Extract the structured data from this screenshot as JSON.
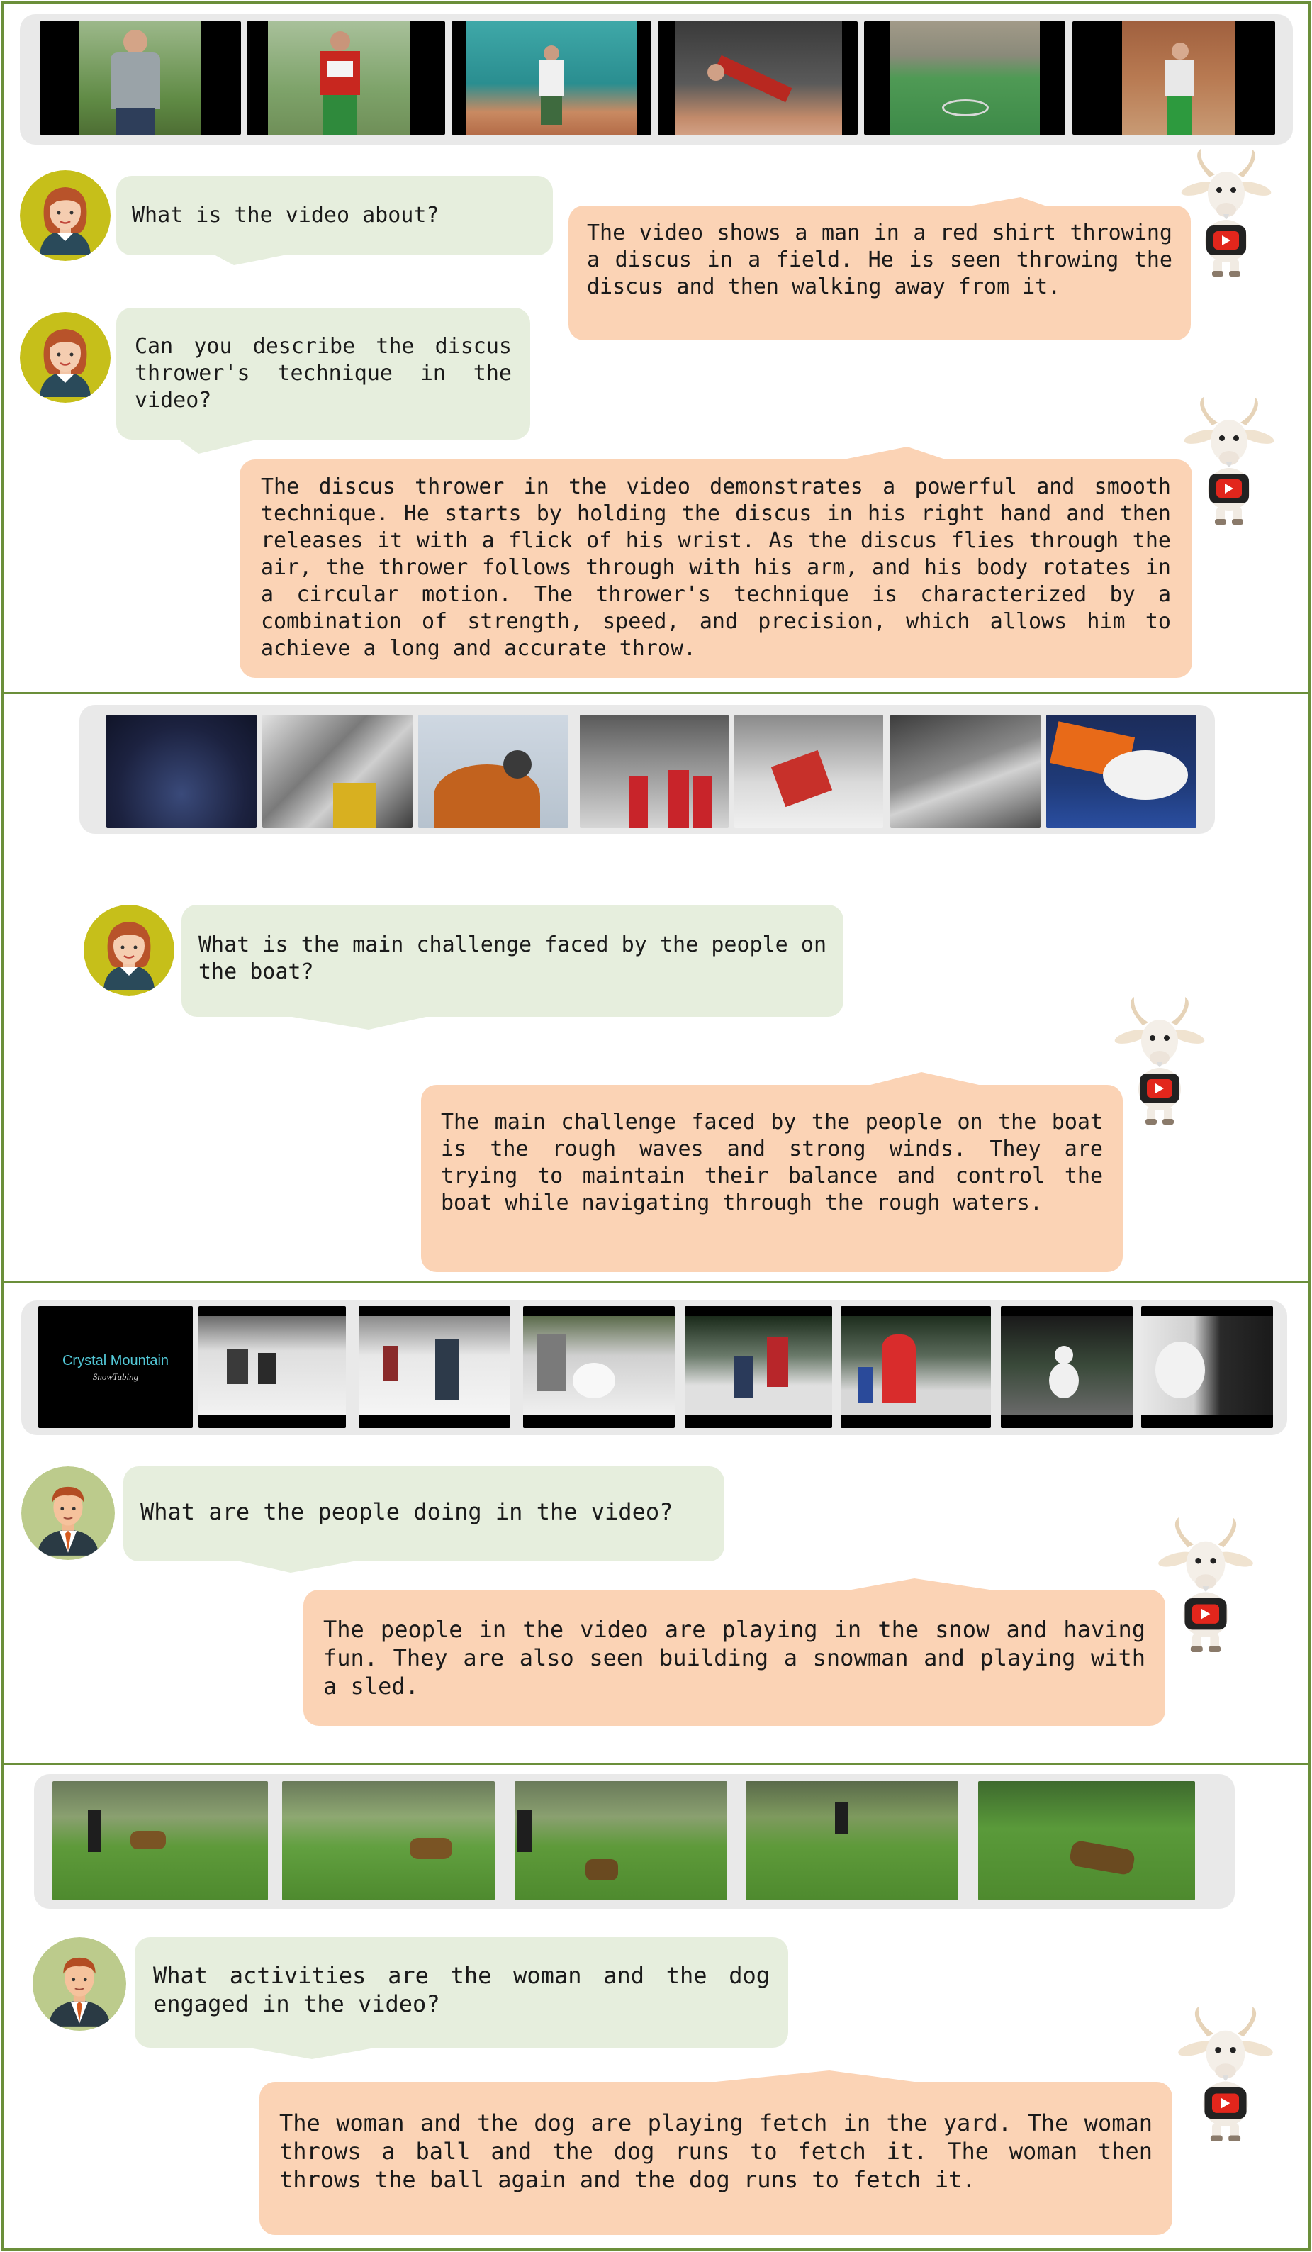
{
  "colors": {
    "panel_border": "#6b8f3a",
    "user_bubble": "#e6eedd",
    "bot_bubble": "#fbd3b5",
    "strip_bg": "#e9e9e9"
  },
  "icons": {
    "user_avatar_woman": "woman-avatar-icon",
    "user_avatar_man": "man-avatar-icon",
    "assistant_avatar": "goat-mascot-icon"
  },
  "panels": [
    {
      "frames": [
        "discus-thrower-portrait",
        "athlete-bib-744",
        "thrower-in-cage",
        "throw-release",
        "field-stadium",
        "thrower-practice"
      ],
      "turns": [
        {
          "role": "user",
          "text": "What is the video about?"
        },
        {
          "role": "assistant",
          "text": "The video shows a man in a red shirt throwing a discus in a field. He is seen throwing the discus and then walking away from it."
        },
        {
          "role": "user",
          "text": "Can you describe the discus thrower's technique in the video?"
        },
        {
          "role": "assistant",
          "text": "The discus thrower in the video demonstrates a powerful and smooth technique. He starts by holding the discus in his right hand and then releases it with a flick of his wrist. As the discus flies through the air, the thrower follows through with his arm, and his body rotates in a circular motion. The thrower's technique is characterized by a combination of strength, speed, and precision, which allows him to achieve a long and accurate throw."
        }
      ]
    },
    {
      "frames": [
        "stormy-sky",
        "boat-deck",
        "sailor-binoculars",
        "crew-red-jackets",
        "boat-splash",
        "rough-sea",
        "sailboat-waves"
      ],
      "turns": [
        {
          "role": "user",
          "text": "What is the main challenge faced by the people on the boat?"
        },
        {
          "role": "assistant",
          "text": "The main challenge faced by the people on the boat is the rough waves and strong winds. They are trying to maintain their balance and control the boat while navigating through the rough waters."
        }
      ]
    },
    {
      "title_card": {
        "title": "Crystal Mountain",
        "subtitle": "SnowTubing"
      },
      "frames": [
        "title-card",
        "sledding-kids",
        "snow-group",
        "rolling-snowball",
        "family-in-snow",
        "red-jacket-kid",
        "snowman",
        "snowman-closeup"
      ],
      "turns": [
        {
          "role": "user",
          "text": "What are the people doing in the video?"
        },
        {
          "role": "assistant",
          "text": "The people in the video are playing in the snow and having fun. They are also seen building a snowman and playing with a sled."
        }
      ]
    },
    {
      "frames": [
        "woman-and-dog",
        "dog-running",
        "dog-fetch",
        "yard-wide",
        "dog-lying-grass"
      ],
      "turns": [
        {
          "role": "user",
          "text": "What activities are the woman and the dog engaged in the video?"
        },
        {
          "role": "assistant",
          "text": "The woman and the dog are playing fetch in the yard. The woman throws a ball and the dog runs to fetch it. The woman then throws the ball again and the dog runs to fetch it."
        }
      ]
    }
  ]
}
